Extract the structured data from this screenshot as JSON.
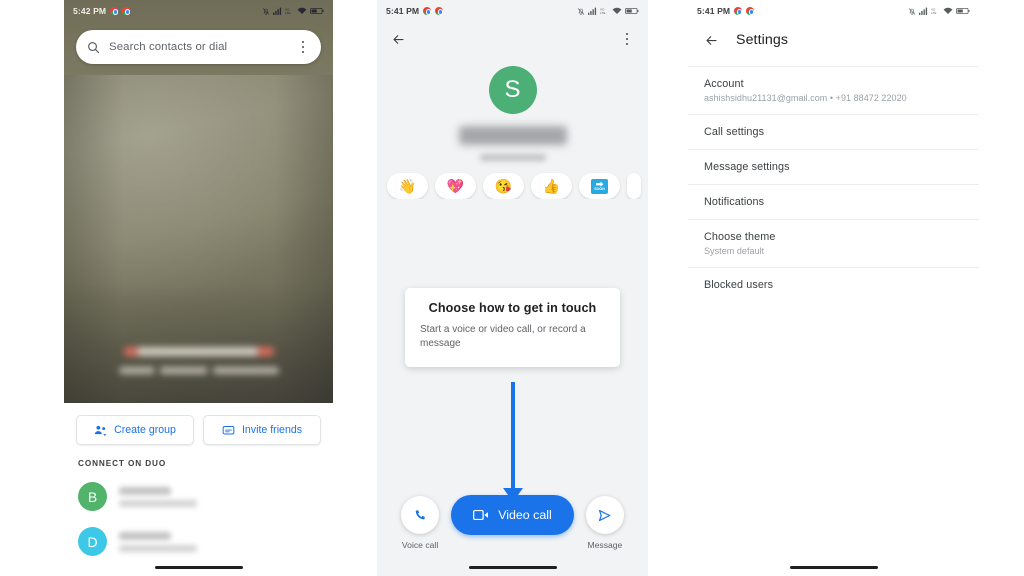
{
  "panel1": {
    "status": {
      "time": "5:42 PM",
      "icons": [
        "chrome-dot",
        "chrome-dot",
        "bell-off-icon",
        "signal-icon",
        "volte-icon",
        "wifi-icon",
        "battery-icon"
      ]
    },
    "search": {
      "placeholder": "Search contacts or dial",
      "icon": "search-icon",
      "overflow_icon": "kebab-menu-icon"
    },
    "buttons": [
      {
        "label": "Create group",
        "icon": "group-add-icon"
      },
      {
        "label": "Invite friends",
        "icon": "message-invite-icon"
      }
    ],
    "section_header": "CONNECT ON DUO",
    "contacts": [
      {
        "initial": "B",
        "color": "#52b36b"
      },
      {
        "initial": "D",
        "color": "#3ec8e8"
      }
    ]
  },
  "panel2": {
    "status": {
      "time": "5:41 PM"
    },
    "appbar": {
      "back_icon": "back-arrow-icon",
      "overflow_icon": "kebab-menu-icon"
    },
    "avatar": {
      "initial": "S",
      "color": "#4caf76"
    },
    "reactions": [
      "👋",
      "💖",
      "😘",
      "👍",
      "soon-sign-icon"
    ],
    "tip": {
      "title": "Choose how to get in touch",
      "body": "Start a voice or video call, or record a message"
    },
    "actions": {
      "voice_label": "Voice call",
      "video_label": "Video call",
      "message_label": "Message"
    },
    "accent": "#1a73e8"
  },
  "panel3": {
    "status": {
      "time": "5:41 PM"
    },
    "title": "Settings",
    "back_icon": "back-arrow-icon",
    "items": [
      {
        "title": "Account",
        "sub": "ashishsidhu21131@gmail.com • +91 88472 22020"
      },
      {
        "title": "Call settings",
        "sub": ""
      },
      {
        "title": "Message settings",
        "sub": ""
      },
      {
        "title": "Notifications",
        "sub": ""
      },
      {
        "title": "Choose theme",
        "sub": "System default"
      },
      {
        "title": "Blocked users",
        "sub": ""
      }
    ]
  }
}
